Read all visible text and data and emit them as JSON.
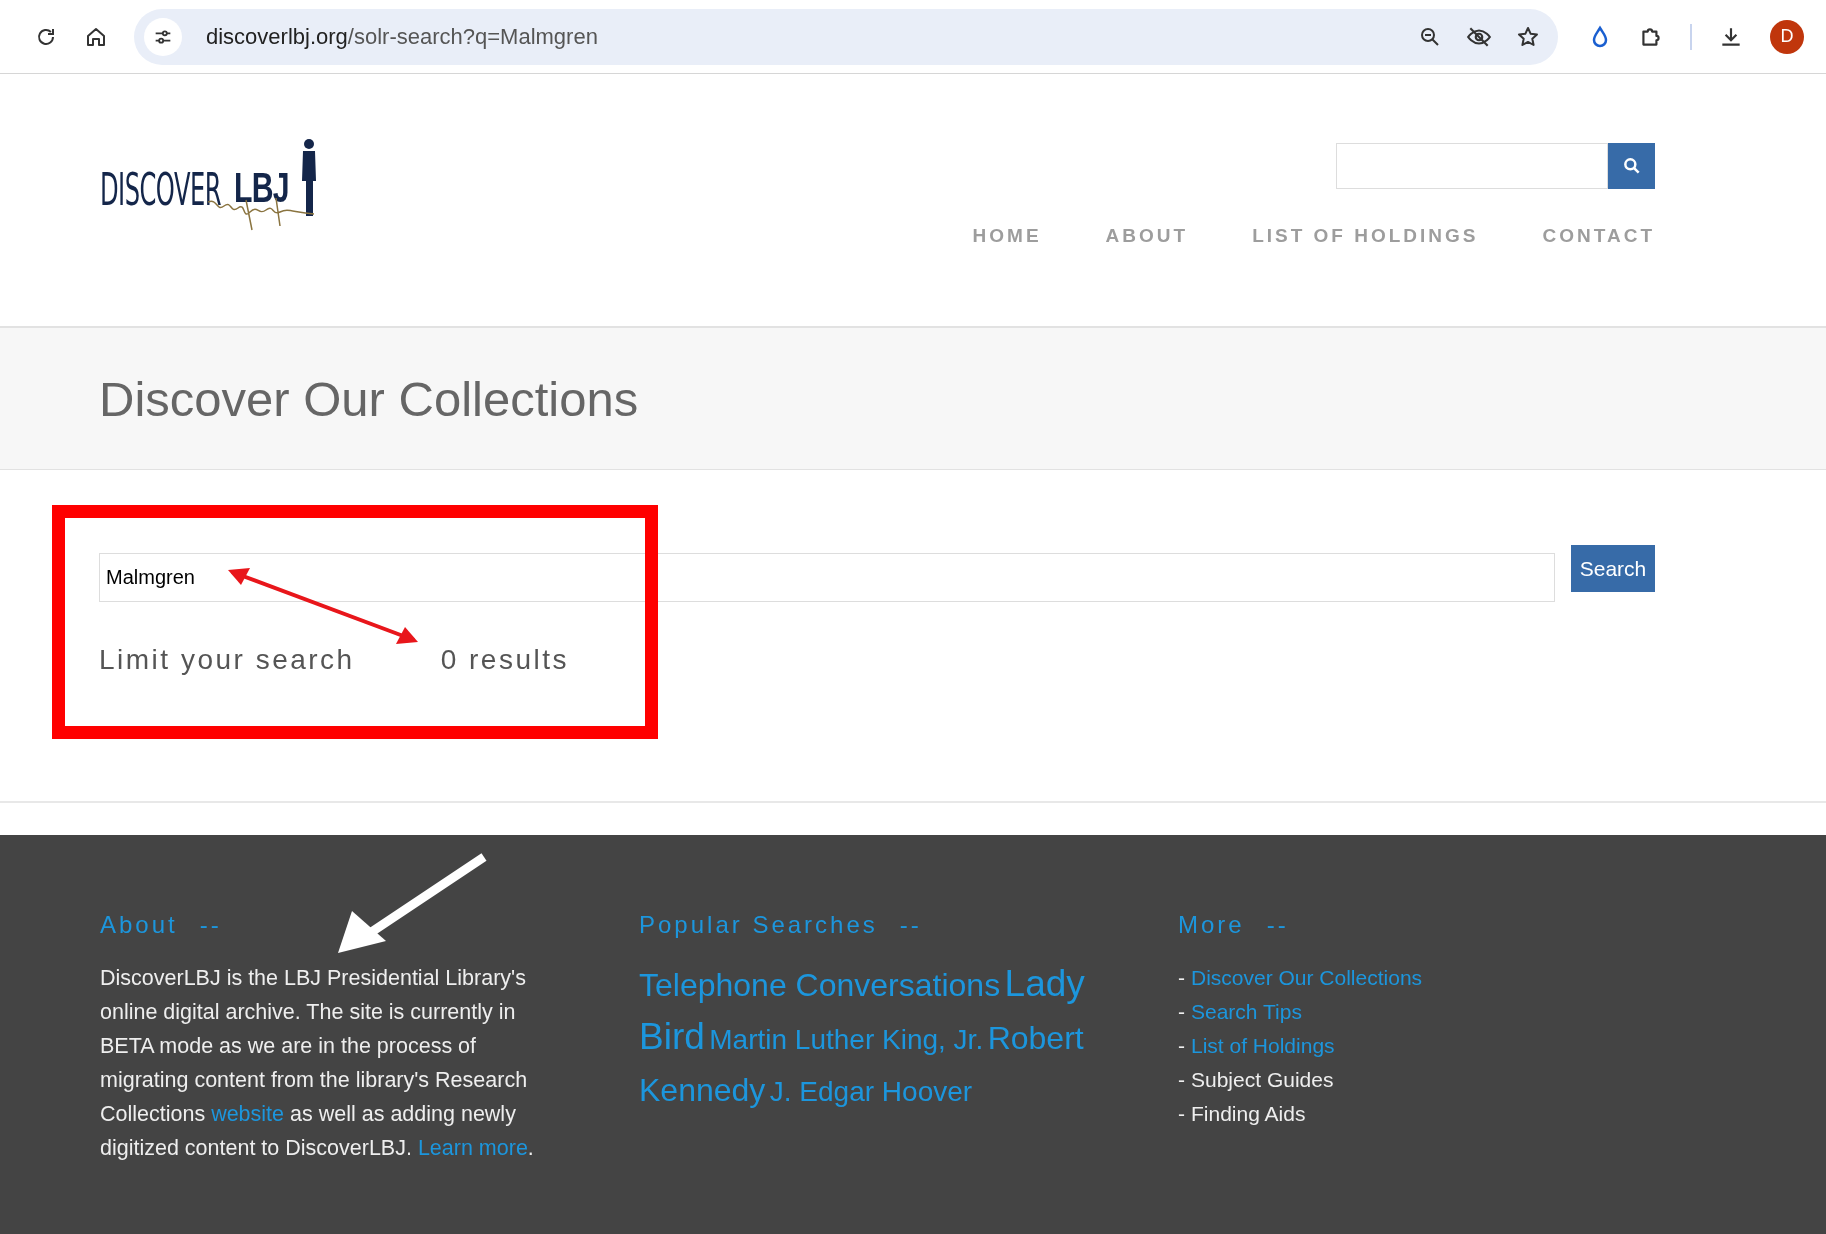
{
  "browser": {
    "url_host": "discoverlbj.org",
    "url_path": "/solr-search?q=Malmgren",
    "profile_initial": "D"
  },
  "header": {
    "logo_text": "DISCOVER",
    "logo_bold": "LBJ",
    "nav": [
      {
        "label": "HOME",
        "selected": false
      },
      {
        "label": "ABOUT",
        "selected": false
      },
      {
        "label": "LIST OF HOLDINGS",
        "selected": false
      },
      {
        "label": "CONTACT",
        "selected": false
      }
    ]
  },
  "page_title": "Discover Our Collections",
  "search": {
    "value": "Malmgren",
    "button": "Search",
    "limit_label": "Limit your search",
    "results_count": "0 results"
  },
  "footer": {
    "about": {
      "heading": "About",
      "dash": "--",
      "paragraph": [
        {
          "kind": "text",
          "text": "DiscoverLBJ is the LBJ Presidential Library's online digital archive. The site is currently in BETA mode as we are in the process of migrating content from the library's Research Collections "
        },
        {
          "kind": "link",
          "text": "website"
        },
        {
          "kind": "text",
          "text": " as well as adding newly digitized content to DiscoverLBJ. "
        },
        {
          "kind": "link",
          "text": "Learn more"
        },
        {
          "kind": "text",
          "text": "."
        }
      ]
    },
    "popular": {
      "heading": "Popular Searches",
      "dash": "--",
      "tags": [
        {
          "text": "Telephone Conversations",
          "kind": "large"
        },
        {
          "text": "Lady Bird",
          "kind": "largest"
        },
        {
          "text": "Martin Luther King, Jr.",
          "kind": "medium"
        },
        {
          "text": "Robert Kennedy",
          "kind": "large"
        },
        {
          "text": "J. Edgar Hoover",
          "kind": "medium"
        }
      ]
    },
    "more": {
      "heading": "More",
      "dash": "--",
      "items": [
        {
          "text": "Discover Our Collections",
          "kind": "link"
        },
        {
          "text": "Search Tips",
          "kind": "link"
        },
        {
          "text": "List of Holdings",
          "kind": "link"
        },
        {
          "text": "Subject Guides",
          "kind": "text"
        },
        {
          "text": "Finding Aids",
          "kind": "text"
        }
      ],
      "bullet": "-"
    }
  }
}
